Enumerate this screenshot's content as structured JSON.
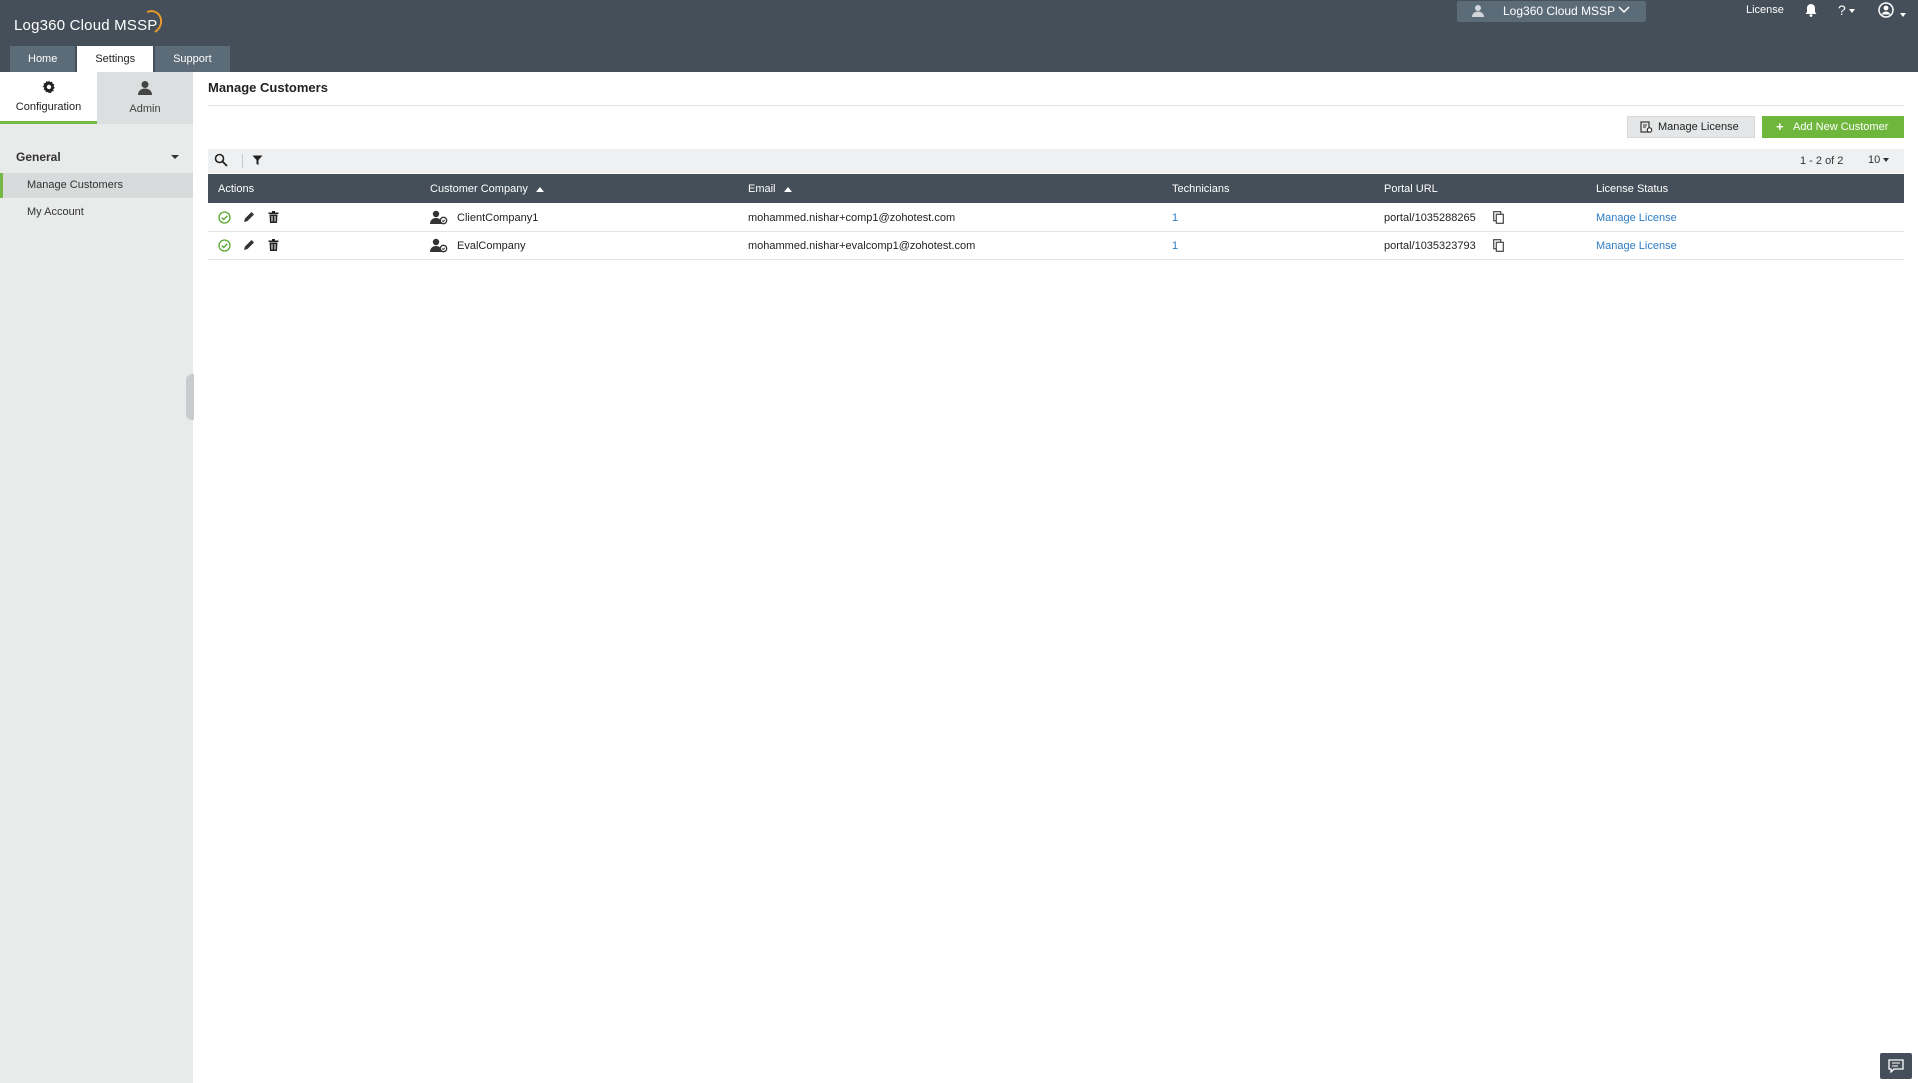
{
  "header": {
    "logo": "Log360 Cloud MSSP",
    "tabs": [
      {
        "label": "Home",
        "active": false
      },
      {
        "label": "Settings",
        "active": true
      },
      {
        "label": "Support",
        "active": false
      }
    ],
    "msp_selector": "Log360 Cloud MSSP",
    "license_link": "License",
    "help": "?"
  },
  "sidebar": {
    "tabs": [
      {
        "label": "Configuration",
        "icon": "gear-icon",
        "active": true
      },
      {
        "label": "Admin",
        "icon": "user-icon",
        "active": false
      }
    ],
    "group": "General",
    "items": [
      {
        "label": "Manage Customers",
        "active": true
      },
      {
        "label": "My Account",
        "active": false
      }
    ]
  },
  "main": {
    "title": "Manage Customers",
    "manage_license_btn": "Manage License",
    "add_customer_btn": "Add New Customer",
    "pager": "1 - 2 of 2",
    "per_page": "10",
    "columns": [
      "Actions",
      "Customer Company",
      "Email",
      "Technicians",
      "Portal URL",
      "License Status"
    ],
    "rows": [
      {
        "company": "ClientCompany1",
        "email": "mohammed.nishar+comp1@zohotest.com",
        "technicians": "1",
        "portal": "portal/1035288265",
        "license": "Manage License"
      },
      {
        "company": "EvalCompany",
        "email": "mohammed.nishar+evalcomp1@zohotest.com",
        "technicians": "1",
        "portal": "portal/1035323793",
        "license": "Manage License"
      }
    ]
  },
  "colors": {
    "header_bg": "#444f59",
    "accent_green": "#6fb63c",
    "link_blue": "#2e7bc4",
    "sidebar_bg": "#e8ebea"
  }
}
